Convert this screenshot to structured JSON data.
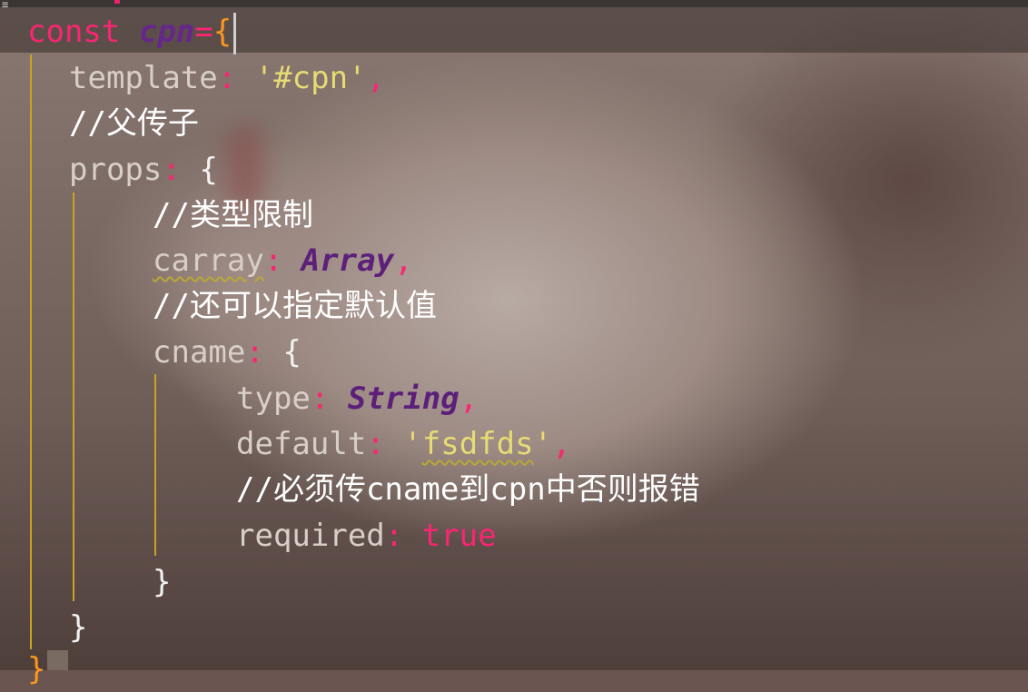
{
  "editor": {
    "menu_icon": "≡",
    "lines": {
      "l1": {
        "kw": "const",
        "name": "cpn",
        "eq": "=",
        "brace": "{"
      },
      "l2": {
        "key": "template",
        "colon": ":",
        "value": "'#cpn'",
        "comma": ","
      },
      "l3": {
        "comment": "//父传子"
      },
      "l4": {
        "key": "props",
        "colon": ":",
        "brace": "{"
      },
      "l5": {
        "comment": "//类型限制"
      },
      "l6": {
        "key": "carray",
        "colon": ":",
        "value": "Array",
        "comma": ","
      },
      "l7": {
        "comment": "//还可以指定默认值"
      },
      "l8": {
        "key": "cname",
        "colon": ":",
        "brace": "{"
      },
      "l9": {
        "key": "type",
        "colon": ":",
        "value": "String",
        "comma": ","
      },
      "l10": {
        "key": "default",
        "colon": ":",
        "q1": "'",
        "value": "fsdfds",
        "q2": "'",
        "comma": ","
      },
      "l11": {
        "comment": "//必须传cname到cpn中否则报错"
      },
      "l12": {
        "key": "required",
        "colon": ":",
        "value": "true"
      },
      "l13": {
        "brace": "}"
      },
      "l14": {
        "brace": "}"
      },
      "l15": {
        "brace": "}"
      }
    }
  }
}
